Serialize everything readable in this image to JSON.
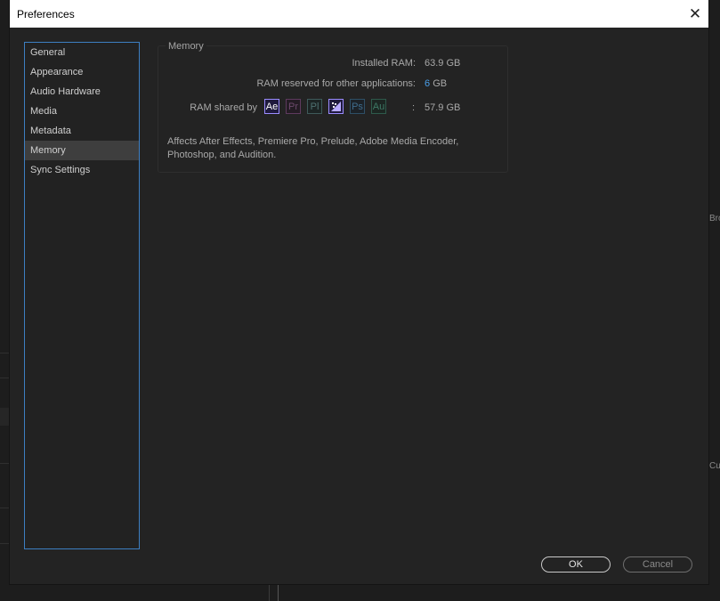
{
  "window": {
    "title": "Preferences"
  },
  "sidebar": {
    "items": [
      {
        "label": "General"
      },
      {
        "label": "Appearance"
      },
      {
        "label": "Audio Hardware"
      },
      {
        "label": "Media"
      },
      {
        "label": "Metadata"
      },
      {
        "label": "Memory",
        "active": true
      },
      {
        "label": "Sync Settings"
      }
    ]
  },
  "memory": {
    "group_title": "Memory",
    "installed_label": "Installed RAM:",
    "installed_value": "63.9 GB",
    "reserved_label": "RAM reserved for other applications:",
    "reserved_number": "6",
    "reserved_unit": "GB",
    "shared_label": "RAM shared by",
    "shared_colon": ":",
    "shared_value": "57.9 GB",
    "apps": [
      {
        "abbr": "Ae",
        "icon": "after-effects-icon"
      },
      {
        "abbr": "Pr",
        "icon": "premiere-pro-icon"
      },
      {
        "abbr": "Pl",
        "icon": "prelude-icon"
      },
      {
        "abbr": "",
        "icon": "media-encoder-icon"
      },
      {
        "abbr": "Ps",
        "icon": "photoshop-icon"
      },
      {
        "abbr": "Au",
        "icon": "audition-icon"
      }
    ],
    "note": "Affects After Effects, Premiere Pro, Prelude, Adobe Media Encoder, Photoshop, and Audition."
  },
  "buttons": {
    "ok": "OK",
    "cancel": "Cancel"
  },
  "background": {
    "right_text_1": "Bro",
    "right_text_2": "Cur"
  },
  "colors": {
    "accent": "#3d7fc2",
    "link": "#4a9fe8",
    "dialog_bg": "#232323"
  }
}
